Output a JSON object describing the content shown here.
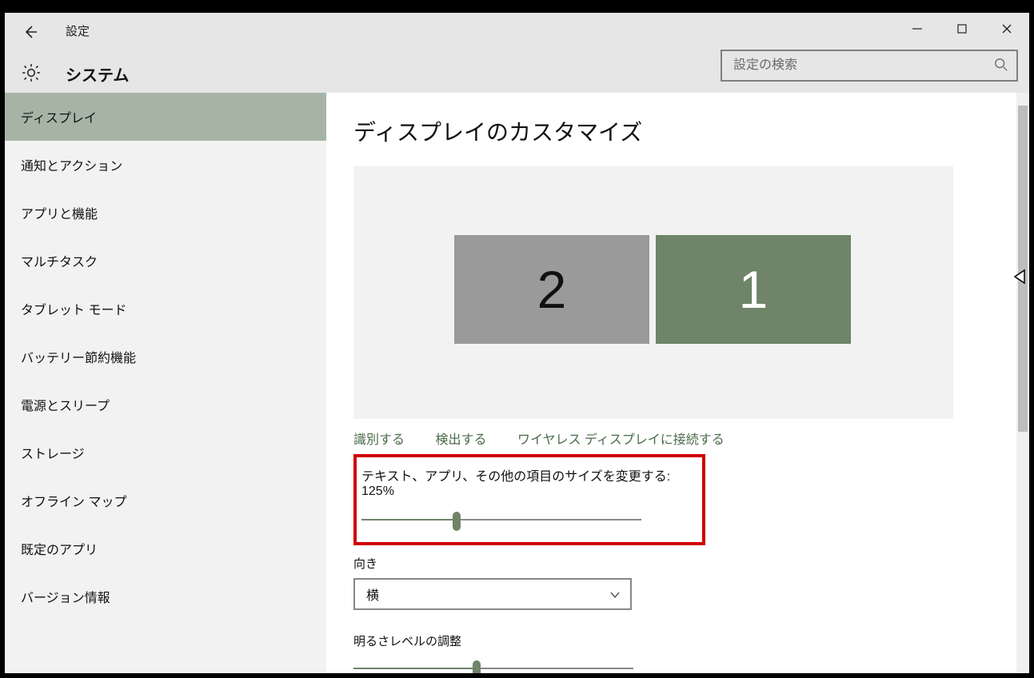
{
  "window": {
    "app_title": "設定",
    "section_title": "システム",
    "search_placeholder": "設定の検索"
  },
  "sidebar": {
    "items": [
      {
        "label": "ディスプレイ",
        "active": true
      },
      {
        "label": "通知とアクション"
      },
      {
        "label": "アプリと機能"
      },
      {
        "label": "マルチタスク"
      },
      {
        "label": "タブレット モード"
      },
      {
        "label": "バッテリー節約機能"
      },
      {
        "label": "電源とスリープ"
      },
      {
        "label": "ストレージ"
      },
      {
        "label": "オフライン マップ"
      },
      {
        "label": "既定のアプリ"
      },
      {
        "label": "バージョン情報"
      }
    ]
  },
  "main": {
    "heading": "ディスプレイのカスタマイズ",
    "monitors": {
      "m1": "1",
      "m2": "2"
    },
    "links": {
      "identify": "識別する",
      "detect": "検出する",
      "wireless": "ワイヤレス ディスプレイに接続する"
    },
    "scale": {
      "label": "テキスト、アプリ、その他の項目のサイズを変更する: 125%",
      "percent": 34
    },
    "orientation": {
      "label": "向き",
      "value": "横"
    },
    "brightness": {
      "label": "明るさレベルの調整",
      "percent": 44
    }
  }
}
